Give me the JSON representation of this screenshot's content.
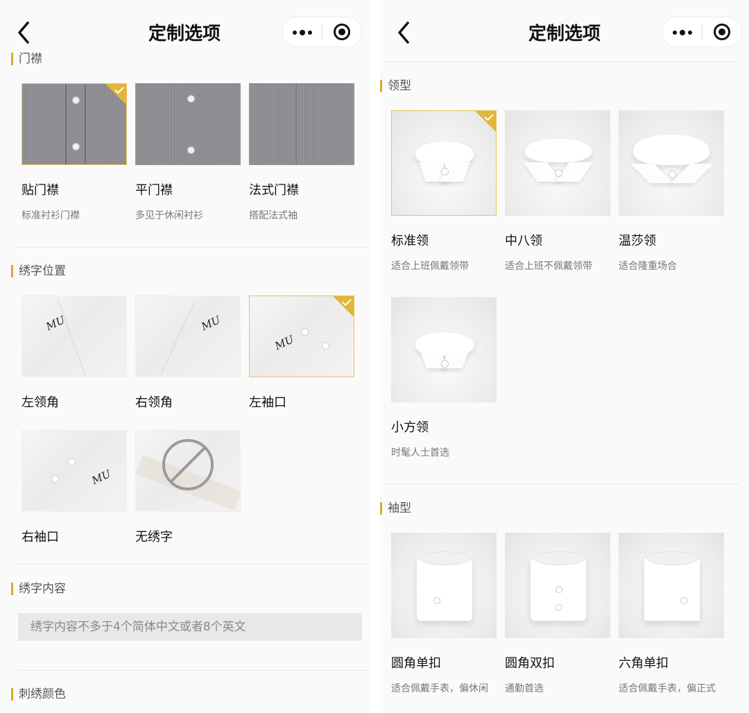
{
  "left": {
    "nav_title": "定制选项",
    "sections": {
      "placket": {
        "title": "门襟",
        "options": [
          {
            "name": "贴门襟",
            "desc": "标准衬衫门襟",
            "selected": true
          },
          {
            "name": "平门襟",
            "desc": "多见于休闲衬衫",
            "selected": false
          },
          {
            "name": "法式门襟",
            "desc": "搭配法式袖",
            "selected": false
          }
        ]
      },
      "embroidery_position": {
        "title": "绣字位置",
        "options": [
          {
            "name": "左领角",
            "selected": false
          },
          {
            "name": "右领角",
            "selected": false
          },
          {
            "name": "左袖口",
            "selected": true
          },
          {
            "name": "右袖口",
            "selected": false
          },
          {
            "name": "无绣字",
            "selected": false
          }
        ],
        "monogram": "MU"
      },
      "embroidery_content": {
        "title": "绣字内容",
        "placeholder": "绣字内容不多于4个简体中文或者8个英文"
      },
      "embroidery_color": {
        "title": "刺绣颜色"
      }
    }
  },
  "right": {
    "nav_title": "定制选项",
    "sections": {
      "collar": {
        "title": "领型",
        "options": [
          {
            "name": "标准领",
            "desc": "适合上班佩戴领带",
            "selected": true
          },
          {
            "name": "中八领",
            "desc": "适合上班不佩戴领带",
            "selected": false
          },
          {
            "name": "温莎领",
            "desc": "适合隆重场合",
            "selected": false
          },
          {
            "name": "小方领",
            "desc": "时髦人士首选",
            "selected": false
          }
        ]
      },
      "cuff": {
        "title": "袖型",
        "options": [
          {
            "name": "圆角单扣",
            "desc": "适合佩戴手表，偏休闲",
            "selected": false
          },
          {
            "name": "圆角双扣",
            "desc": "通勤首选",
            "selected": false
          },
          {
            "name": "六角单扣",
            "desc": "适合佩戴手表，偏正式",
            "selected": false
          }
        ]
      }
    }
  },
  "colors": {
    "accent": "#d9a92a",
    "selected_border": "#e8c35a",
    "placket_fabric": "#8e8e94"
  },
  "icons": {
    "back": "chevron-left-icon",
    "more": "more-dots-icon",
    "close_target": "target-circle-icon",
    "selected_check": "check-icon",
    "no_embroidery": "prohibited-icon"
  }
}
